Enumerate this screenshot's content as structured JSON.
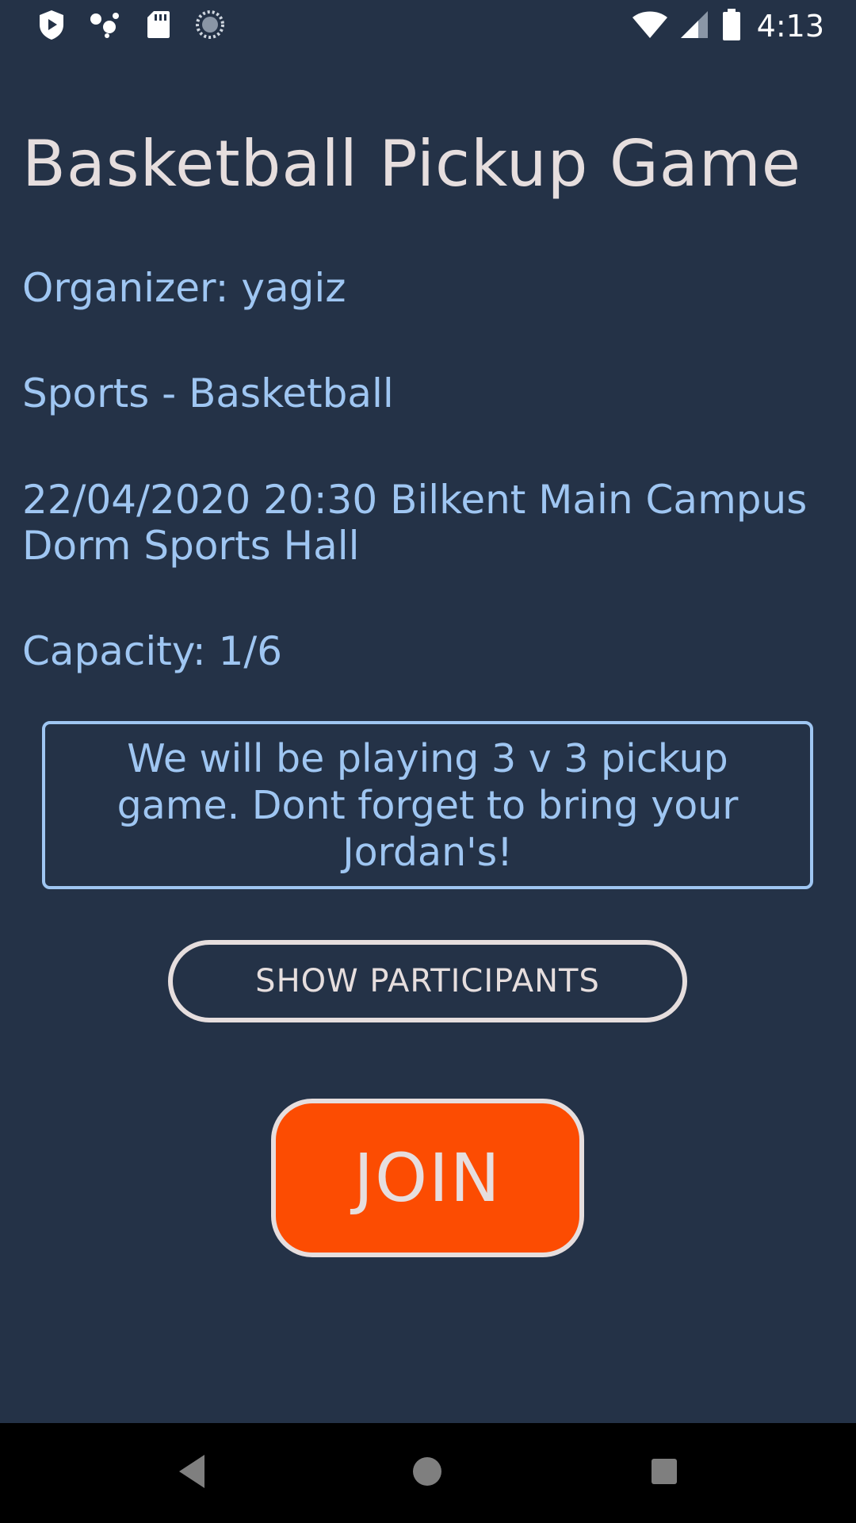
{
  "status_bar": {
    "time": "4:13",
    "left_icons": [
      "play-protect-icon",
      "assistant-dots-icon",
      "sd-card-icon",
      "sync-loading-icon"
    ],
    "right_icons": [
      "wifi-icon",
      "cellular-signal-icon",
      "battery-icon"
    ]
  },
  "event": {
    "title": "Basketball Pickup Game",
    "organizer": "Organizer: yagiz",
    "category": "Sports - Basketball",
    "datetime_line1": "22/04/2020 20:30 Bilkent Main Campus",
    "datetime_line2": "Dorm Sports Hall",
    "capacity": "Capacity: 1/6",
    "description": "We will be playing 3 v 3 pickup game. Dont forget to bring your Jordan's!"
  },
  "actions": {
    "show_participants_label": "SHOW PARTICIPANTS",
    "join_label": "JOIN"
  },
  "nav_bar": {
    "icons": [
      "back-icon",
      "home-icon",
      "recents-icon"
    ]
  },
  "colors": {
    "background": "#243247",
    "accent_text": "#9fc6f2",
    "title_text": "#e6dede",
    "join_button": "#fc4c02"
  }
}
